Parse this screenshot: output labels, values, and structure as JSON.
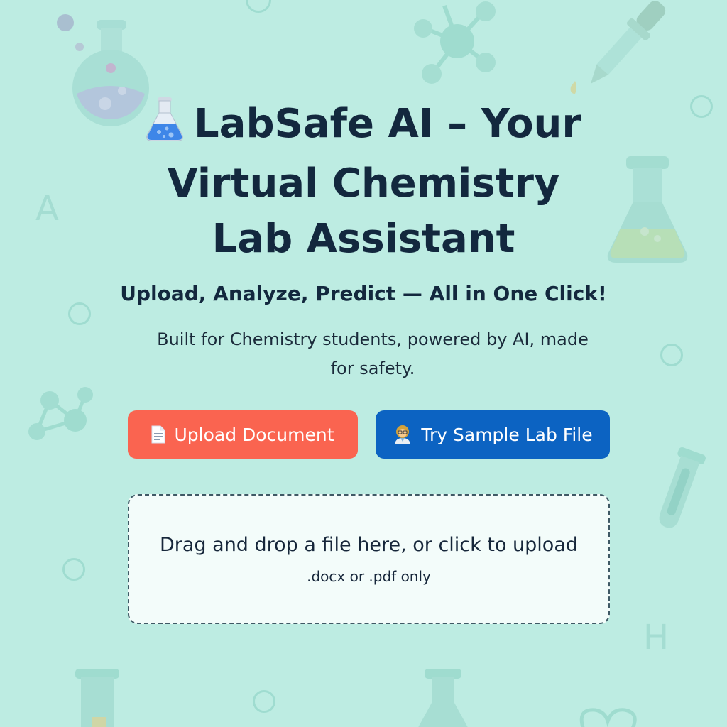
{
  "hero": {
    "title_line1": "LabSafe AI – Your",
    "title_line2": "Virtual Chemistry",
    "title_line3": "Lab Assistant",
    "title_icon": "flask-icon",
    "subtitle": "Upload, Analyze, Predict — All in One Click!",
    "tagline": "Built for Chemistry students, powered by AI, made for safety."
  },
  "actions": {
    "upload_label": "Upload Document",
    "upload_icon": "document-icon",
    "sample_label": "Try Sample Lab File",
    "sample_icon": "scientist-icon"
  },
  "dropzone": {
    "message": "Drag and drop a file here, or click to upload",
    "hint": ".docx or .pdf only"
  },
  "background": {
    "letters": [
      "A",
      "H"
    ]
  },
  "colors": {
    "background": "#bdece2",
    "title_text": "#13283e",
    "upload_button": "#fa6450",
    "sample_button": "#0c63c2",
    "dropzone_bg": "#f3fcfa",
    "dropzone_border": "#3f5965"
  }
}
